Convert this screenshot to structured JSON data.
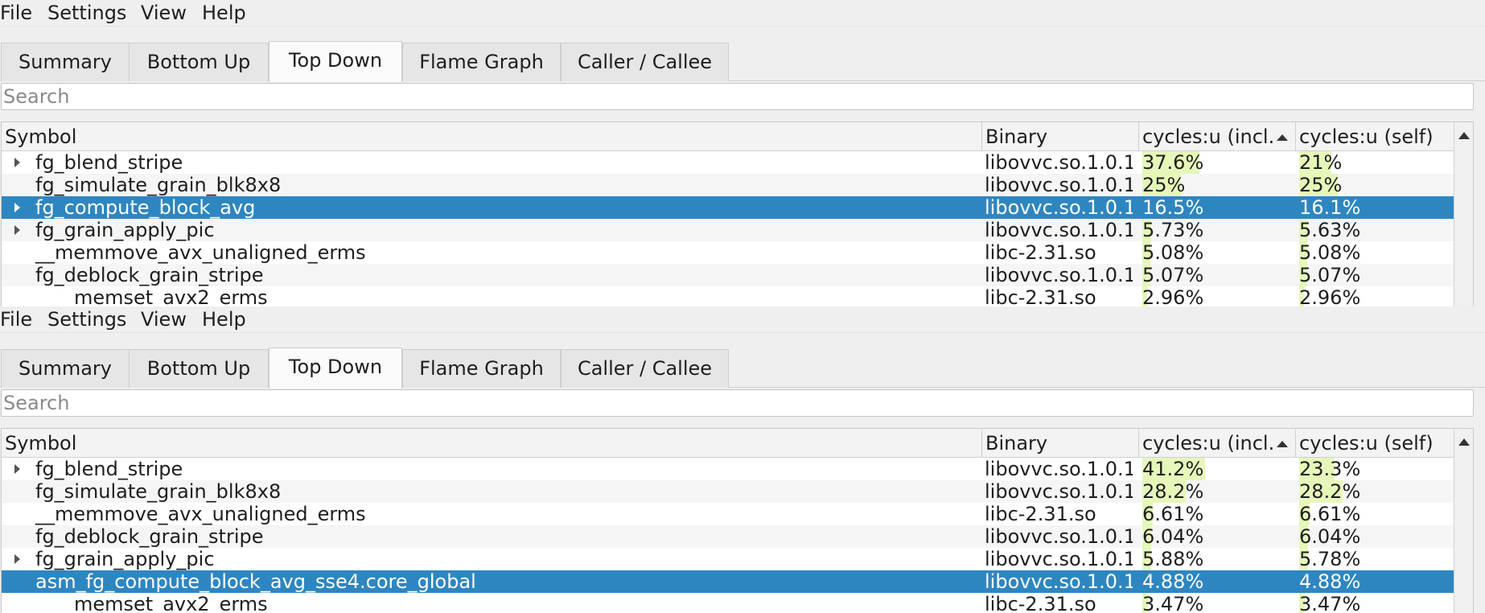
{
  "menu": [
    "File",
    "Settings",
    "View",
    "Help"
  ],
  "tabs": [
    "Summary",
    "Bottom Up",
    "Top Down",
    "Flame Graph",
    "Caller / Callee"
  ],
  "active_tab": "Top Down",
  "search_placeholder": "Search",
  "columns": [
    "Symbol",
    "Binary",
    "cycles:u (incl.",
    "cycles:u (self)"
  ],
  "panels": [
    {
      "rows": [
        {
          "symbol": "fg_blend_stripe",
          "binary": "libovvc.so.1.0.1",
          "incl": "37.6%",
          "self": "21%",
          "incl_pct": 37.6,
          "self_pct": 21,
          "expandable": true,
          "selected": false
        },
        {
          "symbol": "fg_simulate_grain_blk8x8",
          "binary": "libovvc.so.1.0.1",
          "incl": "25%",
          "self": "25%",
          "incl_pct": 25,
          "self_pct": 25,
          "expandable": false,
          "selected": false
        },
        {
          "symbol": "fg_compute_block_avg",
          "binary": "libovvc.so.1.0.1",
          "incl": "16.5%",
          "self": "16.1%",
          "incl_pct": 16.5,
          "self_pct": 16.1,
          "expandable": true,
          "selected": true
        },
        {
          "symbol": "fg_grain_apply_pic",
          "binary": "libovvc.so.1.0.1",
          "incl": "5.73%",
          "self": "5.63%",
          "incl_pct": 5.73,
          "self_pct": 5.63,
          "expandable": true,
          "selected": false
        },
        {
          "symbol": "__memmove_avx_unaligned_erms",
          "binary": "libc-2.31.so",
          "incl": "5.08%",
          "self": "5.08%",
          "incl_pct": 5.08,
          "self_pct": 5.08,
          "expandable": false,
          "selected": false
        },
        {
          "symbol": "fg_deblock_grain_stripe",
          "binary": "libovvc.so.1.0.1",
          "incl": "5.07%",
          "self": "5.07%",
          "incl_pct": 5.07,
          "self_pct": 5.07,
          "expandable": false,
          "selected": false
        },
        {
          "symbol": "__memset_avx2_erms",
          "binary": "libc-2.31.so",
          "incl": "2.96%",
          "self": "2.96%",
          "incl_pct": 2.96,
          "self_pct": 2.96,
          "expandable": false,
          "selected": false
        }
      ]
    },
    {
      "rows": [
        {
          "symbol": "fg_blend_stripe",
          "binary": "libovvc.so.1.0.1",
          "incl": "41.2%",
          "self": "23.3%",
          "incl_pct": 41.2,
          "self_pct": 23.3,
          "expandable": true,
          "selected": false
        },
        {
          "symbol": "fg_simulate_grain_blk8x8",
          "binary": "libovvc.so.1.0.1",
          "incl": "28.2%",
          "self": "28.2%",
          "incl_pct": 28.2,
          "self_pct": 28.2,
          "expandable": false,
          "selected": false
        },
        {
          "symbol": "__memmove_avx_unaligned_erms",
          "binary": "libc-2.31.so",
          "incl": "6.61%",
          "self": "6.61%",
          "incl_pct": 6.61,
          "self_pct": 6.61,
          "expandable": false,
          "selected": false
        },
        {
          "symbol": "fg_deblock_grain_stripe",
          "binary": "libovvc.so.1.0.1",
          "incl": "6.04%",
          "self": "6.04%",
          "incl_pct": 6.04,
          "self_pct": 6.04,
          "expandable": false,
          "selected": false
        },
        {
          "symbol": "fg_grain_apply_pic",
          "binary": "libovvc.so.1.0.1",
          "incl": "5.88%",
          "self": "5.78%",
          "incl_pct": 5.88,
          "self_pct": 5.78,
          "expandable": true,
          "selected": false
        },
        {
          "symbol": "asm_fg_compute_block_avg_sse4.core_global",
          "binary": "libovvc.so.1.0.1",
          "incl": "4.88%",
          "self": "4.88%",
          "incl_pct": 4.88,
          "self_pct": 4.88,
          "expandable": false,
          "selected": true
        },
        {
          "symbol": "__memset_avx2_erms",
          "binary": "libc-2.31.so",
          "incl": "3.47%",
          "self": "3.47%",
          "incl_pct": 3.47,
          "self_pct": 3.47,
          "expandable": false,
          "selected": false
        }
      ]
    }
  ],
  "colors": {
    "selection": "#2e86c1",
    "cost_bar": "#e6f7ba"
  }
}
